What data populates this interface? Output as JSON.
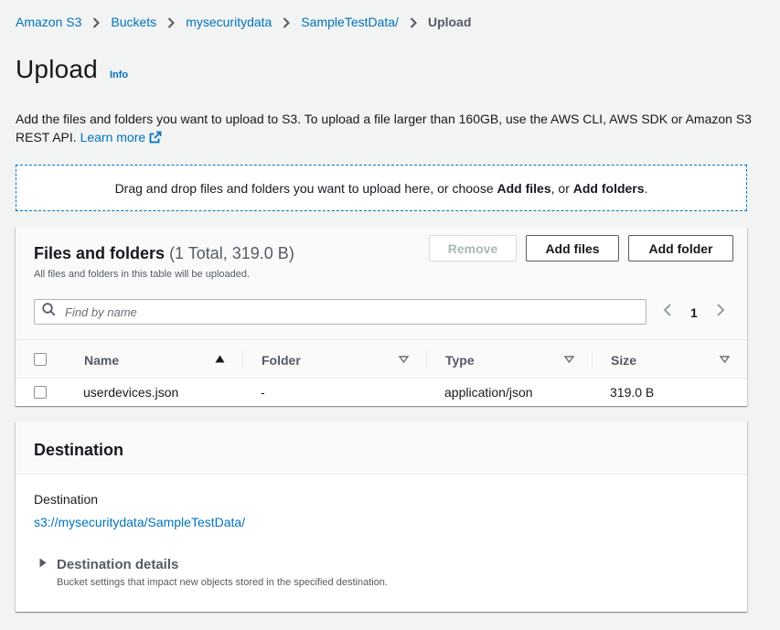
{
  "breadcrumb": {
    "items": [
      "Amazon S3",
      "Buckets",
      "mysecuritydata",
      "SampleTestData/"
    ],
    "current": "Upload"
  },
  "page": {
    "title": "Upload",
    "info": "Info",
    "description": "Add the files and folders you want to upload to S3. To upload a file larger than 160GB, use the AWS CLI, AWS SDK or Amazon S3 REST API.",
    "learn_more": "Learn more"
  },
  "dropzone": {
    "text_before": "Drag and drop files and folders you want to upload here, or choose ",
    "add_files": "Add files",
    "text_middle": ", or ",
    "add_folders": "Add folders",
    "text_after": "."
  },
  "files": {
    "title": "Files and folders",
    "count": "(1 Total, 319.0 B)",
    "subtitle": "All files and folders in this table will be uploaded.",
    "remove_label": "Remove",
    "add_files_label": "Add files",
    "add_folder_label": "Add folder",
    "search_placeholder": "Find by name",
    "page": "1",
    "columns": [
      "Name",
      "Folder",
      "Type",
      "Size"
    ],
    "rows": [
      {
        "name": "userdevices.json",
        "folder": "-",
        "type": "application/json",
        "size": "319.0 B"
      }
    ]
  },
  "destination": {
    "title": "Destination",
    "label": "Destination",
    "path": "s3://mysecuritydata/SampleTestData/",
    "details_title": "Destination details",
    "details_subtitle": "Bucket settings that impact new objects stored in the specified destination."
  },
  "colors": {
    "link": "#0073bb",
    "text": "#16191f",
    "muted": "#545b64",
    "background": "#f2f3f3"
  }
}
